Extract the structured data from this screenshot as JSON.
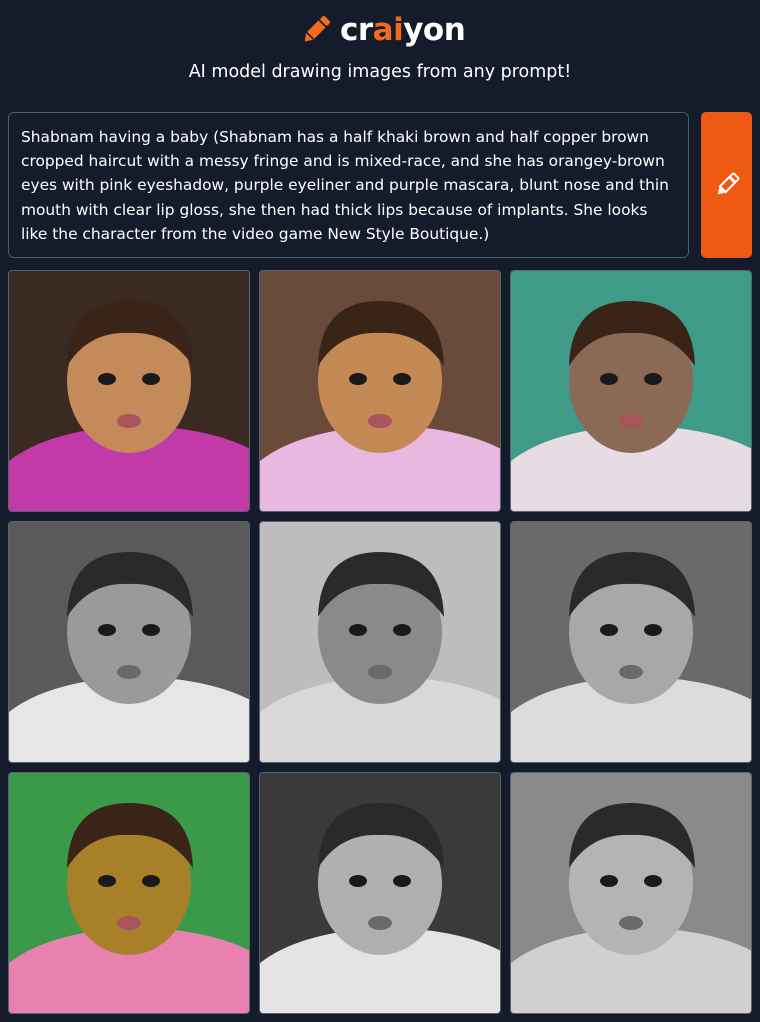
{
  "header": {
    "logo_prefix": "cr",
    "logo_accent": "ai",
    "logo_suffix": "yon",
    "logo_icon": "pencil-icon",
    "tagline": "AI model drawing images from any prompt!"
  },
  "prompt": {
    "text": "Shabnam having a baby (Shabnam has a half khaki brown and half copper brown cropped haircut with a messy fringe and is mixed-race, and she has orangey-brown eyes with pink eyeshadow, purple eyeliner and purple mascara, blunt nose and thin mouth with clear lip gloss, she then had thick lips because of implants. She looks like the character from the video game New Style Boutique.)"
  },
  "draw_button": {
    "icon": "pencil-icon"
  },
  "colors": {
    "background": "#141b2b",
    "accent": "#ee5a14",
    "text": "#ffffff",
    "border": "#505a6b"
  },
  "results": {
    "images": [
      {
        "name": "generated-image-1",
        "palette": "color",
        "bg": "#3a2a22",
        "fg": "#c48a5a",
        "cloth": "#c23aa8"
      },
      {
        "name": "generated-image-2",
        "palette": "color",
        "bg": "#6a4a3a",
        "fg": "#c48a55",
        "cloth": "#e8b8e0"
      },
      {
        "name": "generated-image-3",
        "palette": "color",
        "bg": "#3f9a88",
        "fg": "#8a6a55",
        "cloth": "#e8dce4"
      },
      {
        "name": "generated-image-4",
        "palette": "mono",
        "bg": "#5a5a5a",
        "fg": "#9a9a9a",
        "cloth": "#e6e6e6"
      },
      {
        "name": "generated-image-5",
        "palette": "mono",
        "bg": "#bdbdbd",
        "fg": "#8a8a8a",
        "cloth": "#d8d8d8"
      },
      {
        "name": "generated-image-6",
        "palette": "mono",
        "bg": "#6a6a6a",
        "fg": "#a8a8a8",
        "cloth": "#dcdcdc"
      },
      {
        "name": "generated-image-7",
        "palette": "color",
        "bg": "#3a9a4a",
        "fg": "#a8802a",
        "cloth": "#e880b0"
      },
      {
        "name": "generated-image-8",
        "palette": "mono",
        "bg": "#3a3a3a",
        "fg": "#b0b0b0",
        "cloth": "#e4e4e4"
      },
      {
        "name": "generated-image-9",
        "palette": "mono",
        "bg": "#8a8a8a",
        "fg": "#b4b4b4",
        "cloth": "#d0d0d0"
      }
    ]
  }
}
